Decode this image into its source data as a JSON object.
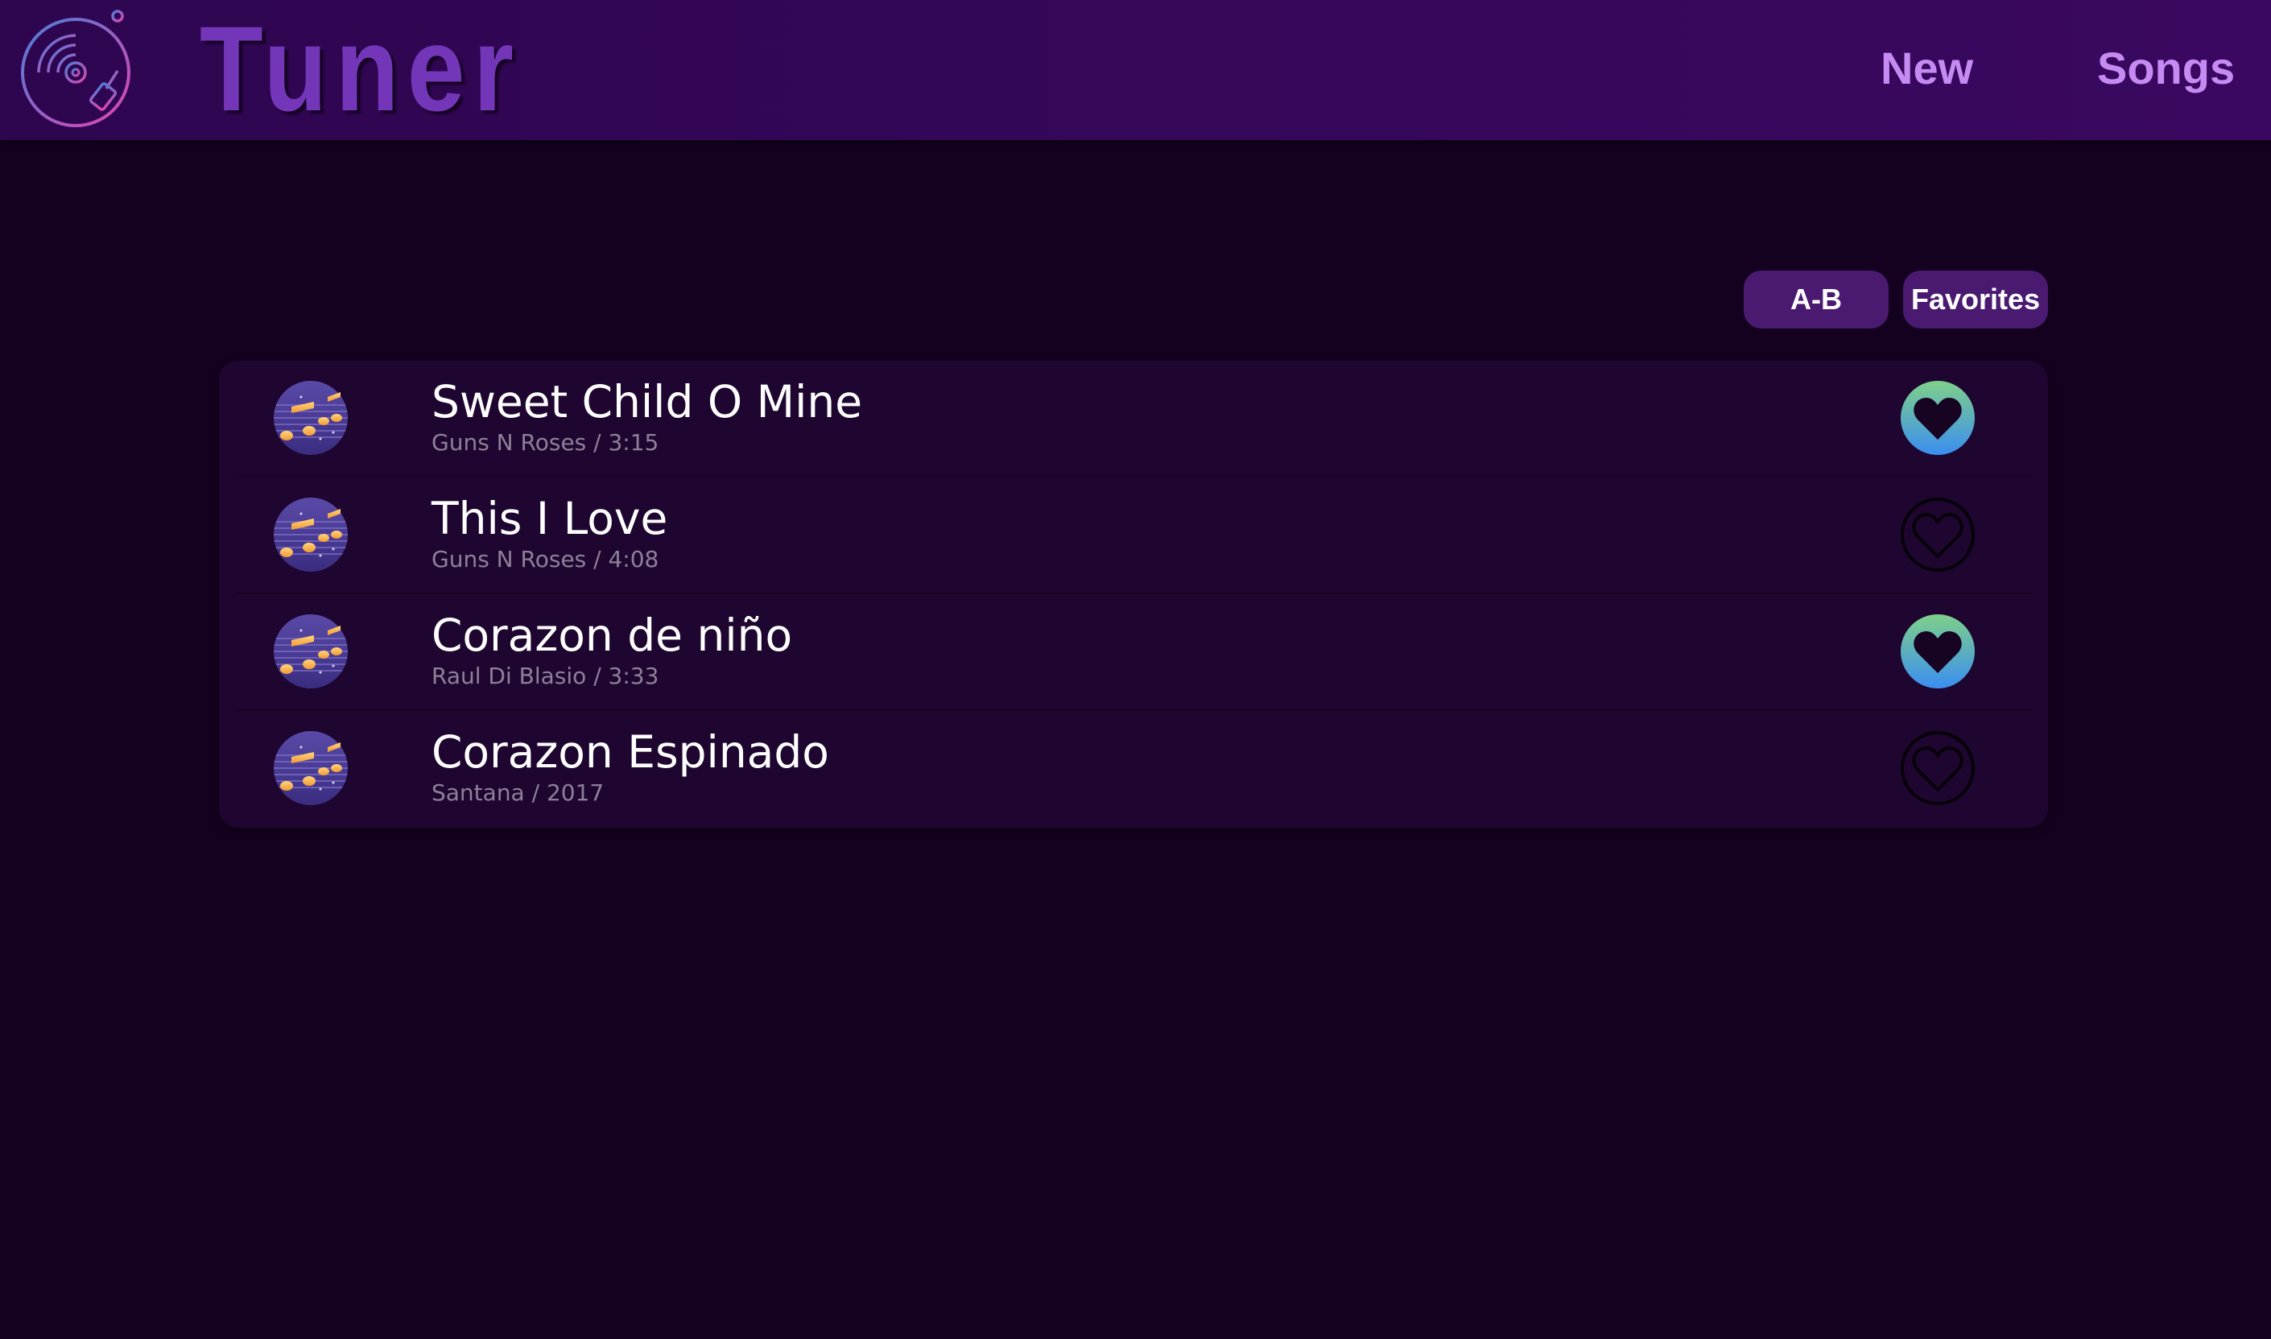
{
  "app": {
    "title": "Tuner"
  },
  "nav": {
    "new_label": "New",
    "songs_label": "Songs"
  },
  "sort": {
    "ab_label": "A-B",
    "favorites_label": "Favorites"
  },
  "songs": [
    {
      "title": "Sweet Child O Mine",
      "subtitle": "Guns N Roses / 3:15",
      "favorite": true
    },
    {
      "title": "This I Love",
      "subtitle": "Guns N Roses / 4:08",
      "favorite": false
    },
    {
      "title": "Corazon de niño",
      "subtitle": "Raul Di Blasio / 3:33",
      "favorite": true
    },
    {
      "title": "Corazon Espinado",
      "subtitle": "Santana / 2017",
      "favorite": false
    }
  ],
  "icons": {
    "logo": "turntable-icon",
    "song_art": "music-notes-icon",
    "favorite_on": "heart-filled-icon",
    "favorite_off": "heart-outline-icon"
  },
  "colors": {
    "background": "#14001f",
    "header": "#35075a",
    "accent": "#7436b8",
    "nav_text": "#c58bf2",
    "button": "#4a1a70",
    "list_bg": "#1f0630",
    "favorite_gradient_start": "#7fd08a",
    "favorite_gradient_end": "#3a8ef0"
  }
}
